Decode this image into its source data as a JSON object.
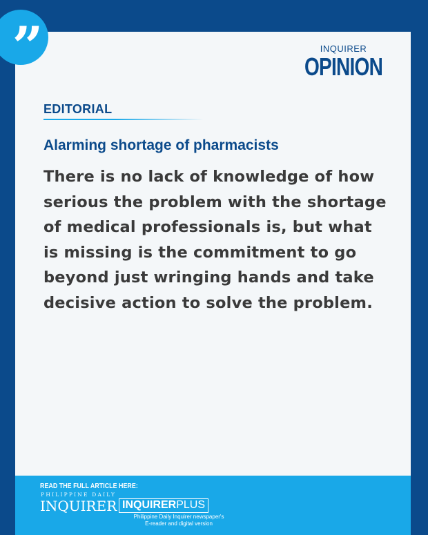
{
  "brand": {
    "top": "INQUIRER",
    "main": "OPINION"
  },
  "section_label": "EDITORIAL",
  "headline": "Alarming shortage of pharmacists",
  "body": "There is no lack of knowledge of how serious the problem with the shortage of medical professionals is, but what is missing is the commitment to go beyond just wringing hands and take decisive action to solve the problem.",
  "footer": {
    "label": "READ THE FULL ARTICLE HERE:",
    "pdi_top": "PHILIPPINE DAILY",
    "pdi_main": "INQUIRER",
    "plus_bold": "INQUIRER",
    "plus_light": "PLUS",
    "plus_caption_line1": "Philippine Daily Inquirer newspaper's",
    "plus_caption_line2": "E-reader and digital version"
  },
  "icons": {
    "quote": "quote-icon"
  },
  "colors": {
    "navy": "#0b4a8b",
    "accent": "#19a8e8",
    "card": "#f4f7f9",
    "text": "#3a3a3a"
  }
}
